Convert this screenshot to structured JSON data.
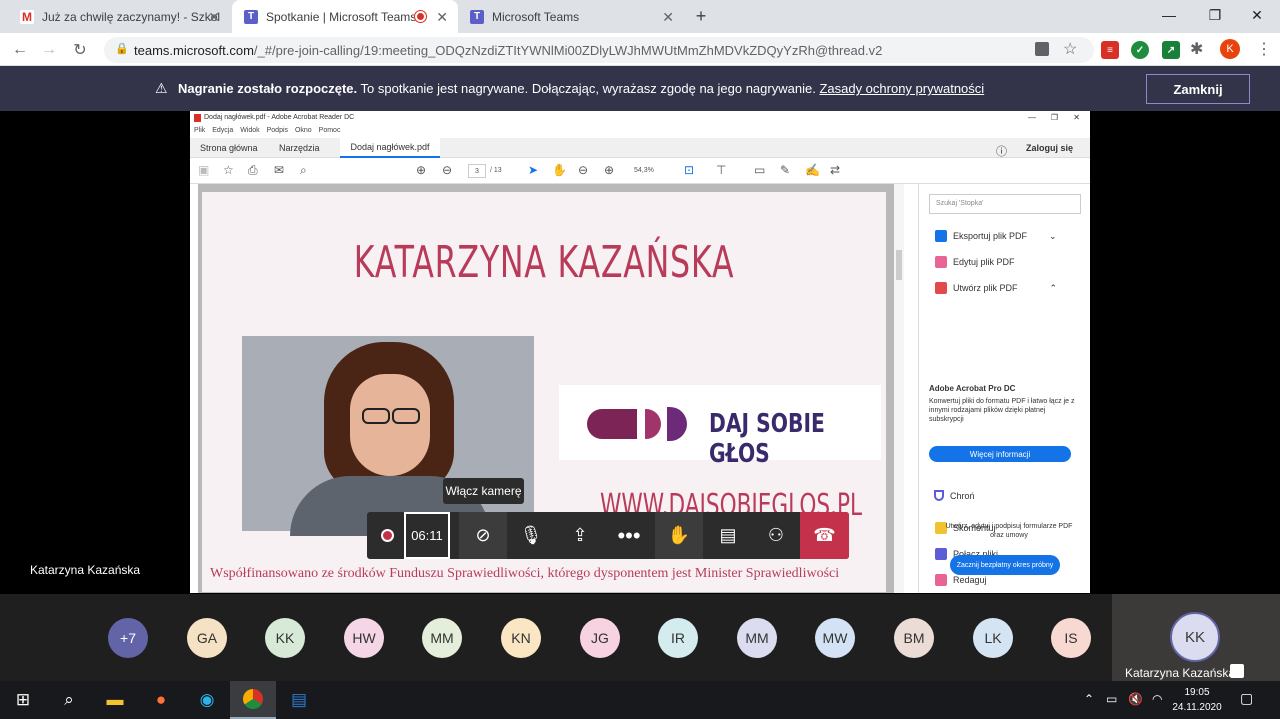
{
  "browser": {
    "tabs": [
      {
        "title": "Już za chwilę zaczynamy! - Szkol",
        "favicon": "gmail-icon"
      },
      {
        "title": "Spotkanie | Microsoft Teams",
        "favicon": "teams-icon"
      },
      {
        "title": "Microsoft Teams",
        "favicon": "teams-icon"
      }
    ],
    "new_tab": "+",
    "url_host": "teams.microsoft.com",
    "url_path": "/_#/pre-join-calling/19:meeting_ODQzNzdiZTItYWNlMi00ZDlyLWJhMWUtMmZhMDVkZDQyYzRh@thread.v2",
    "profile_initial": "K"
  },
  "banner": {
    "bold": "Nagranie zostało rozpoczęte.",
    "text": "To spotkanie jest nagrywane. Dołączając, wyrażasz zgodę na jego nagrywanie.",
    "link": "Zasady ochrony prywatności",
    "close": "Zamknij"
  },
  "acrobat": {
    "window_title": "Dodaj nagłówek.pdf - Adobe Acrobat Reader DC",
    "menu": [
      "Plik",
      "Edycja",
      "Widok",
      "Podpis",
      "Okno",
      "Pomoc"
    ],
    "tabs": [
      "Strona główna",
      "Narzędzia",
      "Dodaj nagłówek.pdf"
    ],
    "login": "Zaloguj się",
    "page_current": "3",
    "page_total": "/ 13",
    "zoom": "54,3%",
    "pdf": {
      "title": "KATARZYNA KAZAŃSKA",
      "logo_text": "DAJ SOBIE GŁOS",
      "website": "WWW.DAJSOBIEGLOS.PL",
      "footer": "Współfinansowano ze środków Funduszu Sprawiedliwości, którego dysponentem jest Minister Sprawiedliwości"
    },
    "right_pane": {
      "search_placeholder": "Szukaj 'Stopka'",
      "items": [
        "Eksportuj plik PDF",
        "Edytuj plik PDF",
        "Utwórz plik PDF"
      ],
      "promo_title": "Adobe Acrobat Pro DC",
      "promo_text": "Konwertuj pliki do formatu PDF i łatwo łącz je z innymi rodzajami plików dzięki płatnej subskrypcji",
      "more_info": "Więcej informacji",
      "tools": [
        "Skomentuj",
        "Połącz pliki",
        "Redaguj",
        "Chroń"
      ],
      "bottom_text": "Utwórz, edytuj i podpisuj formularze PDF oraz umowy",
      "trial": "Zacznij bezpłatny okres próbny"
    }
  },
  "presenter_name": "Katarzyna Kazańska",
  "controls": {
    "timer": "06:11",
    "tooltip": "Włącz kamerę"
  },
  "participants": [
    {
      "initials": "+7",
      "color": "#6264a7",
      "fg": "#ffffff"
    },
    {
      "initials": "GA",
      "color": "#f5e1c3",
      "fg": "#333333"
    },
    {
      "initials": "KK",
      "color": "#d7ead8",
      "fg": "#333333"
    },
    {
      "initials": "HW",
      "color": "#f5d6e6",
      "fg": "#333333"
    },
    {
      "initials": "MM",
      "color": "#e4eedb",
      "fg": "#333333"
    },
    {
      "initials": "KN",
      "color": "#fbe6c4",
      "fg": "#333333"
    },
    {
      "initials": "JG",
      "color": "#f7d3e1",
      "fg": "#333333"
    },
    {
      "initials": "IR",
      "color": "#d4ecee",
      "fg": "#333333"
    },
    {
      "initials": "MM",
      "color": "#dcdcf0",
      "fg": "#333333"
    },
    {
      "initials": "MW",
      "color": "#d3e3f5",
      "fg": "#333333"
    },
    {
      "initials": "BM",
      "color": "#ecdcd6",
      "fg": "#333333"
    },
    {
      "initials": "LK",
      "color": "#d4e4f2",
      "fg": "#333333"
    },
    {
      "initials": "IS",
      "color": "#f8d9d2",
      "fg": "#333333"
    }
  ],
  "self": {
    "initials": "KK",
    "name": "Katarzyna Kazańska"
  },
  "clock": {
    "time": "19:05",
    "date": "24.11.2020"
  },
  "colors": {
    "teams_purple": "#6264a7",
    "end_call_red": "#c4314b",
    "pdf_accent": "#b83b5a"
  }
}
